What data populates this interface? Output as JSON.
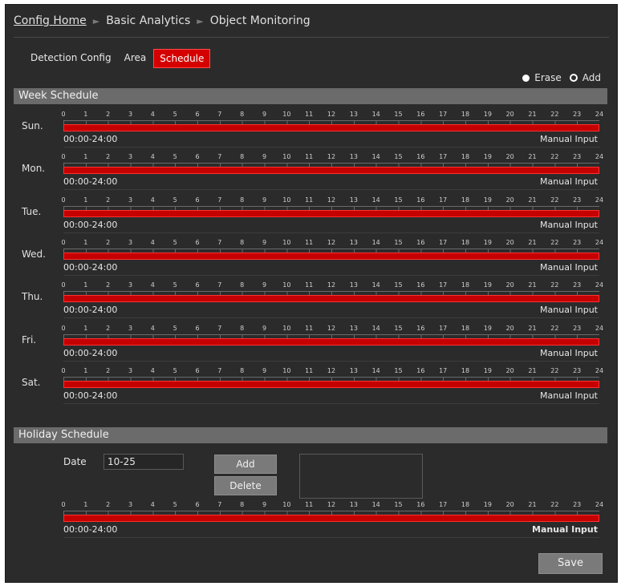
{
  "breadcrumb": {
    "home": "Config Home",
    "section": "Basic Analytics",
    "page": "Object Monitoring"
  },
  "tabs": [
    {
      "label": "Detection Config",
      "active": false
    },
    {
      "label": "Area",
      "active": false
    },
    {
      "label": "Schedule",
      "active": true
    }
  ],
  "mode": {
    "erase_label": "Erase",
    "add_label": "Add",
    "selected": "Erase"
  },
  "week_schedule": {
    "title": "Week Schedule",
    "hours": [
      "0",
      "1",
      "2",
      "3",
      "4",
      "5",
      "6",
      "7",
      "8",
      "9",
      "10",
      "11",
      "12",
      "13",
      "14",
      "15",
      "16",
      "17",
      "18",
      "19",
      "20",
      "21",
      "22",
      "23",
      "24"
    ],
    "days": [
      {
        "label": "Sun.",
        "range": "00:00-24:00",
        "manual": "Manual Input"
      },
      {
        "label": "Mon.",
        "range": "00:00-24:00",
        "manual": "Manual Input"
      },
      {
        "label": "Tue.",
        "range": "00:00-24:00",
        "manual": "Manual Input"
      },
      {
        "label": "Wed.",
        "range": "00:00-24:00",
        "manual": "Manual Input"
      },
      {
        "label": "Thu.",
        "range": "00:00-24:00",
        "manual": "Manual Input"
      },
      {
        "label": "Fri.",
        "range": "00:00-24:00",
        "manual": "Manual Input"
      },
      {
        "label": "Sat.",
        "range": "00:00-24:00",
        "manual": "Manual Input"
      }
    ]
  },
  "holiday_schedule": {
    "title": "Holiday Schedule",
    "date_label": "Date",
    "date_value": "10-25",
    "add_label": "Add",
    "delete_label": "Delete",
    "range": "00:00-24:00",
    "manual": "Manual Input"
  },
  "save_label": "Save",
  "colors": {
    "accent": "#d40000",
    "background": "#2b2b2b",
    "header": "#6b6b6b"
  }
}
